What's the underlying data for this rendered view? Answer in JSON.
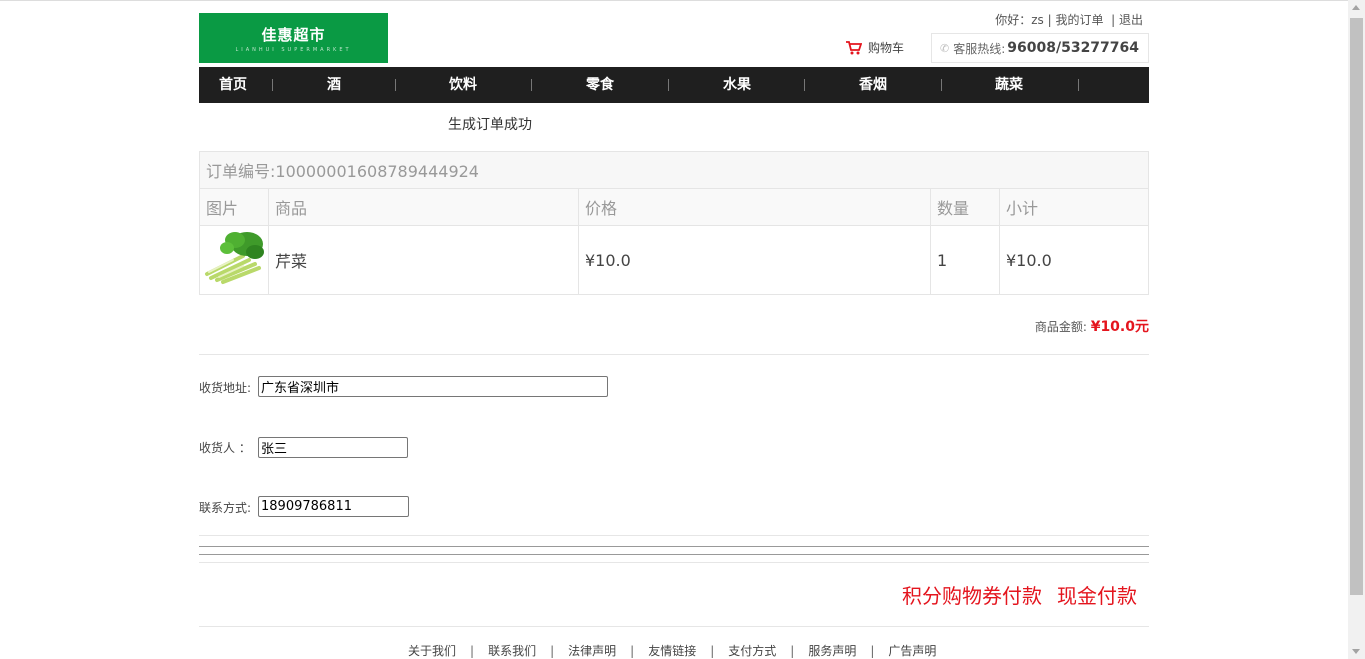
{
  "header": {
    "logo_text": "佳惠超市",
    "logo_sub": "LIANHUI SUPERMARKET",
    "greeting": "你好：",
    "username": "zs",
    "my_orders": "我的订单",
    "logout": "退出",
    "cart_label": "购物车",
    "hotline_label": "客服热线:",
    "hotline_number": "96008/53277764"
  },
  "nav": {
    "items": [
      "首页",
      "酒",
      "饮料",
      "零食",
      "水果",
      "香烟",
      "蔬菜"
    ]
  },
  "order": {
    "success_message": "生成订单成功",
    "order_number_label": "订单编号:10000001608789444924",
    "columns": {
      "image": "图片",
      "product": "商品",
      "price": "价格",
      "quantity": "数量",
      "subtotal": "小计"
    },
    "items": [
      {
        "name": "芹菜",
        "price": "¥10.0",
        "quantity": "1",
        "subtotal": "¥10.0",
        "image_icon": "celery-image"
      }
    ],
    "total_label": "商品金额:",
    "total_value": "¥10.0元"
  },
  "form": {
    "address_label": "收货地址:",
    "address_value": "广东省深圳市",
    "receiver_label": "收货人 ：",
    "receiver_value": "张三",
    "contact_label": "联系方式:",
    "contact_value": "18909786811"
  },
  "payment": {
    "points_pay": "积分购物券付款",
    "cash_pay": "现金付款"
  },
  "footer": {
    "links": [
      "关于我们",
      "联系我们",
      "法律声明",
      "友情链接",
      "支付方式",
      "服务声明",
      "广告声明"
    ]
  },
  "colors": {
    "brand_green": "#0a9a44",
    "nav_bg": "#1f1f1f",
    "accent_red": "#e4151e"
  }
}
